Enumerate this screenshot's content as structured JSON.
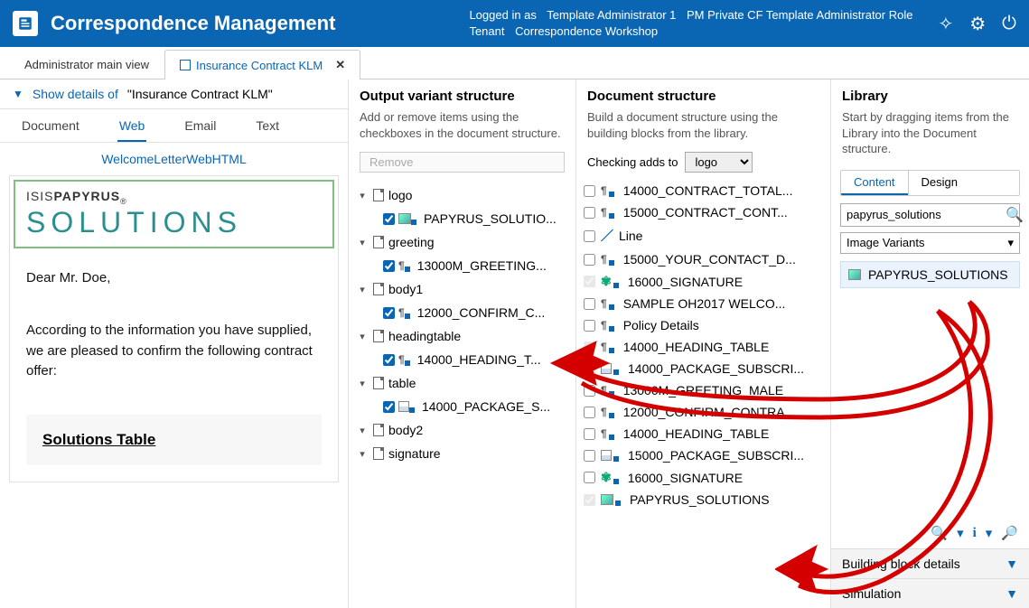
{
  "header": {
    "title": "Correspondence Management",
    "logged_in_as_label": "Logged in as",
    "user": "Template Administrator 1",
    "role": "PM Private CF Template Administrator Role",
    "tenant_label": "Tenant",
    "tenant": "Correspondence Workshop"
  },
  "tabs": [
    {
      "label": "Administrator main view",
      "active": false
    },
    {
      "label": "Insurance Contract KLM",
      "active": true,
      "closable": true
    }
  ],
  "details": {
    "show_label": "Show details of",
    "doc_name": "\"Insurance Contract KLM\""
  },
  "mode_tabs": [
    "Document",
    "Web",
    "Email",
    "Text"
  ],
  "mode_active": "Web",
  "preview_title": "WelcomeLetterWebHTML",
  "preview": {
    "brand_small": "ISISPAPYRUS",
    "brand_big": "SOLUTIONS",
    "greeting": "Dear Mr. Doe,",
    "body": "According to the information you have supplied, we are pleased to confirm the following contract offer:",
    "table_title": "Solutions Table"
  },
  "output_variant": {
    "title": "Output variant structure",
    "desc": "Add or remove items using the checkboxes in the document structure.",
    "remove_btn": "Remove",
    "tree": [
      {
        "label": "logo",
        "children": [
          {
            "label": "PAPYRUS_SOLUTIO...",
            "icon": "img",
            "checked": true
          }
        ]
      },
      {
        "label": "greeting",
        "children": [
          {
            "label": "13000M_GREETING...",
            "icon": "para",
            "checked": true
          }
        ]
      },
      {
        "label": "body1",
        "children": [
          {
            "label": "12000_CONFIRM_C...",
            "icon": "para",
            "checked": true
          }
        ]
      },
      {
        "label": "headingtable",
        "children": [
          {
            "label": "14000_HEADING_T...",
            "icon": "para",
            "checked": true
          }
        ]
      },
      {
        "label": "table",
        "children": [
          {
            "label": "14000_PACKAGE_S...",
            "icon": "table",
            "checked": true
          }
        ]
      },
      {
        "label": "body2",
        "children": []
      },
      {
        "label": "signature",
        "children": []
      }
    ]
  },
  "doc_structure": {
    "title": "Document structure",
    "desc": "Build a document structure using the building blocks from the library.",
    "checking_label": "Checking adds to",
    "checking_value": "logo",
    "items": [
      {
        "label": "14000_CONTRACT_TOTAL...",
        "icon": "para",
        "checked": false
      },
      {
        "label": "15000_CONTRACT_CONT...",
        "icon": "para",
        "checked": false
      },
      {
        "label": "Line",
        "icon": "line",
        "checked": false
      },
      {
        "label": "15000_YOUR_CONTACT_D...",
        "icon": "para",
        "checked": false
      },
      {
        "label": "16000_SIGNATURE",
        "icon": "sig",
        "checked": true,
        "locked": true
      },
      {
        "label": "SAMPLE OH2017 WELCO...",
        "icon": "para",
        "checked": false
      },
      {
        "label": "Policy Details",
        "icon": "para",
        "checked": false
      },
      {
        "label": "14000_HEADING_TABLE",
        "icon": "para",
        "checked": true,
        "locked": true
      },
      {
        "label": "14000_PACKAGE_SUBSCRI...",
        "icon": "table",
        "checked": true,
        "locked": true
      },
      {
        "label": "13000M_GREETING_MALE",
        "icon": "para",
        "checked": false
      },
      {
        "label": "12000_CONFIRM_CONTRA...",
        "icon": "para",
        "checked": false
      },
      {
        "label": "14000_HEADING_TABLE",
        "icon": "para",
        "checked": false
      },
      {
        "label": "15000_PACKAGE_SUBSCRI...",
        "icon": "table",
        "checked": false
      },
      {
        "label": "16000_SIGNATURE",
        "icon": "sig",
        "checked": false
      },
      {
        "label": "PAPYRUS_SOLUTIONS",
        "icon": "img",
        "checked": true,
        "locked": true
      }
    ]
  },
  "library": {
    "title": "Library",
    "desc": "Start by dragging items from the Library into the Document structure.",
    "tabs": [
      "Content",
      "Design"
    ],
    "tab_active": "Content",
    "search_value": "papyrus_solutions",
    "filter": "Image Variants",
    "result": "PAPYRUS_SOLUTIONS",
    "acc_blocks": "Building block details",
    "acc_sim": "Simulation"
  }
}
